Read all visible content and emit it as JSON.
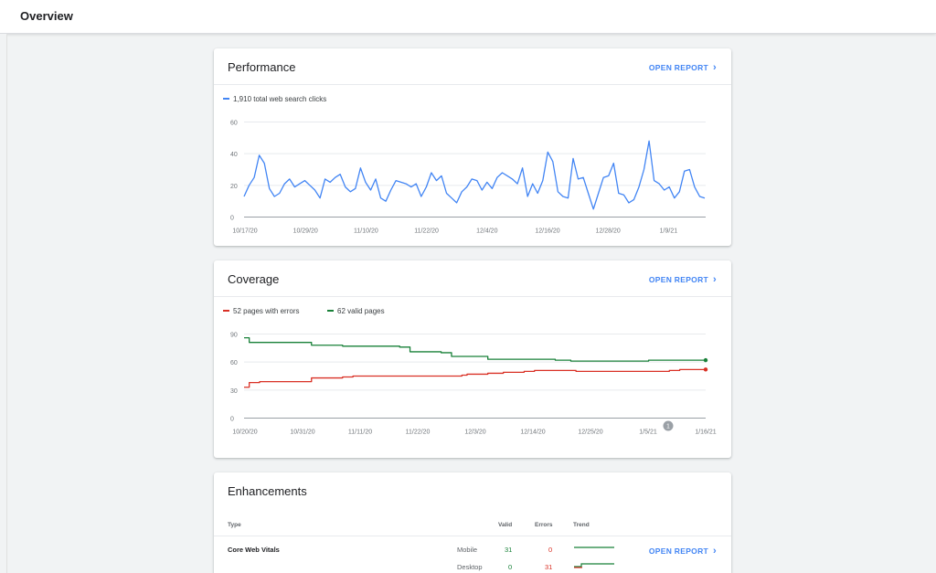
{
  "page": {
    "title": "Overview"
  },
  "performance": {
    "title": "Performance",
    "open_report": "OPEN REPORT",
    "legend": "1,910 total web search clicks",
    "color": "#4285f4"
  },
  "coverage": {
    "title": "Coverage",
    "open_report": "OPEN REPORT",
    "legend_errors": "52 pages with errors",
    "legend_valid": "62 valid pages",
    "color_errors": "#d93025",
    "color_valid": "#188038",
    "annotation": "1"
  },
  "enhancements": {
    "title": "Enhancements",
    "columns": {
      "type": "Type",
      "valid": "Valid",
      "errors": "Errors",
      "trend": "Trend"
    },
    "rows": [
      {
        "type": "Core Web Vitals",
        "device": "Mobile",
        "valid": "31",
        "errors": "0",
        "open_report": "OPEN REPORT"
      },
      {
        "type": "",
        "device": "Desktop",
        "valid": "0",
        "errors": "31"
      }
    ]
  },
  "chart_data": [
    {
      "type": "line",
      "x_tick_labels": [
        "10/17/20",
        "10/29/20",
        "11/10/20",
        "11/22/20",
        "12/4/20",
        "12/16/20",
        "12/28/20",
        "1/9/21"
      ],
      "y_ticks": [
        0,
        20,
        40,
        60
      ],
      "ylim": [
        0,
        60
      ],
      "series": [
        {
          "name": "1,910 total web search clicks",
          "color": "#4285f4",
          "values": [
            13,
            20,
            25,
            39,
            34,
            18,
            13,
            15,
            21,
            24,
            19,
            21,
            23,
            20,
            17,
            12,
            24,
            22,
            25,
            27,
            19,
            16,
            18,
            31,
            22,
            17,
            24,
            12,
            10,
            17,
            23,
            22,
            21,
            19,
            21,
            13,
            19,
            28,
            23,
            26,
            15,
            12,
            9,
            16,
            19,
            24,
            23,
            17,
            22,
            18,
            25,
            28,
            26,
            24,
            21,
            31,
            13,
            21,
            15,
            23,
            41,
            35,
            16,
            13,
            12,
            37,
            24,
            25,
            15,
            5,
            15,
            25,
            26,
            34,
            15,
            14,
            9,
            11,
            19,
            30,
            48,
            23,
            21,
            17,
            19,
            12,
            16,
            29,
            30,
            19,
            13,
            12
          ]
        }
      ]
    },
    {
      "type": "line",
      "x_tick_labels": [
        "10/20/20",
        "10/31/20",
        "11/11/20",
        "11/22/20",
        "12/3/20",
        "12/14/20",
        "12/25/20",
        "1/5/21",
        "1/16/21"
      ],
      "y_ticks": [
        0,
        30,
        60,
        90
      ],
      "ylim": [
        0,
        90
      ],
      "series": [
        {
          "name": "62 valid pages",
          "color": "#188038",
          "values": [
            86,
            81,
            81,
            81,
            81,
            81,
            81,
            81,
            81,
            81,
            81,
            81,
            81,
            78,
            78,
            78,
            78,
            78,
            78,
            77,
            77,
            77,
            77,
            77,
            77,
            77,
            77,
            77,
            77,
            77,
            76,
            76,
            71,
            71,
            71,
            71,
            71,
            71,
            70,
            70,
            66,
            66,
            66,
            66,
            66,
            66,
            66,
            63,
            63,
            63,
            63,
            63,
            63,
            63,
            63,
            63,
            63,
            63,
            63,
            63,
            62,
            62,
            62,
            61,
            61,
            61,
            61,
            61,
            61,
            61,
            61,
            61,
            61,
            61,
            61,
            61,
            61,
            61,
            62,
            62,
            62,
            62,
            62,
            62,
            62,
            62,
            62,
            62,
            62,
            62
          ]
        },
        {
          "name": "52 pages with errors",
          "color": "#d93025",
          "values": [
            33,
            38,
            38,
            39,
            39,
            39,
            39,
            39,
            39,
            39,
            39,
            39,
            39,
            43,
            43,
            43,
            43,
            43,
            43,
            44,
            44,
            45,
            45,
            45,
            45,
            45,
            45,
            45,
            45,
            45,
            45,
            45,
            45,
            45,
            45,
            45,
            45,
            45,
            45,
            45,
            45,
            45,
            46,
            47,
            47,
            47,
            47,
            48,
            48,
            48,
            49,
            49,
            49,
            49,
            50,
            50,
            51,
            51,
            51,
            51,
            51,
            51,
            51,
            51,
            50,
            50,
            50,
            50,
            50,
            50,
            50,
            50,
            50,
            50,
            50,
            50,
            50,
            50,
            50,
            50,
            50,
            50,
            51,
            51,
            52,
            52,
            52,
            52,
            52,
            52
          ]
        }
      ]
    }
  ]
}
